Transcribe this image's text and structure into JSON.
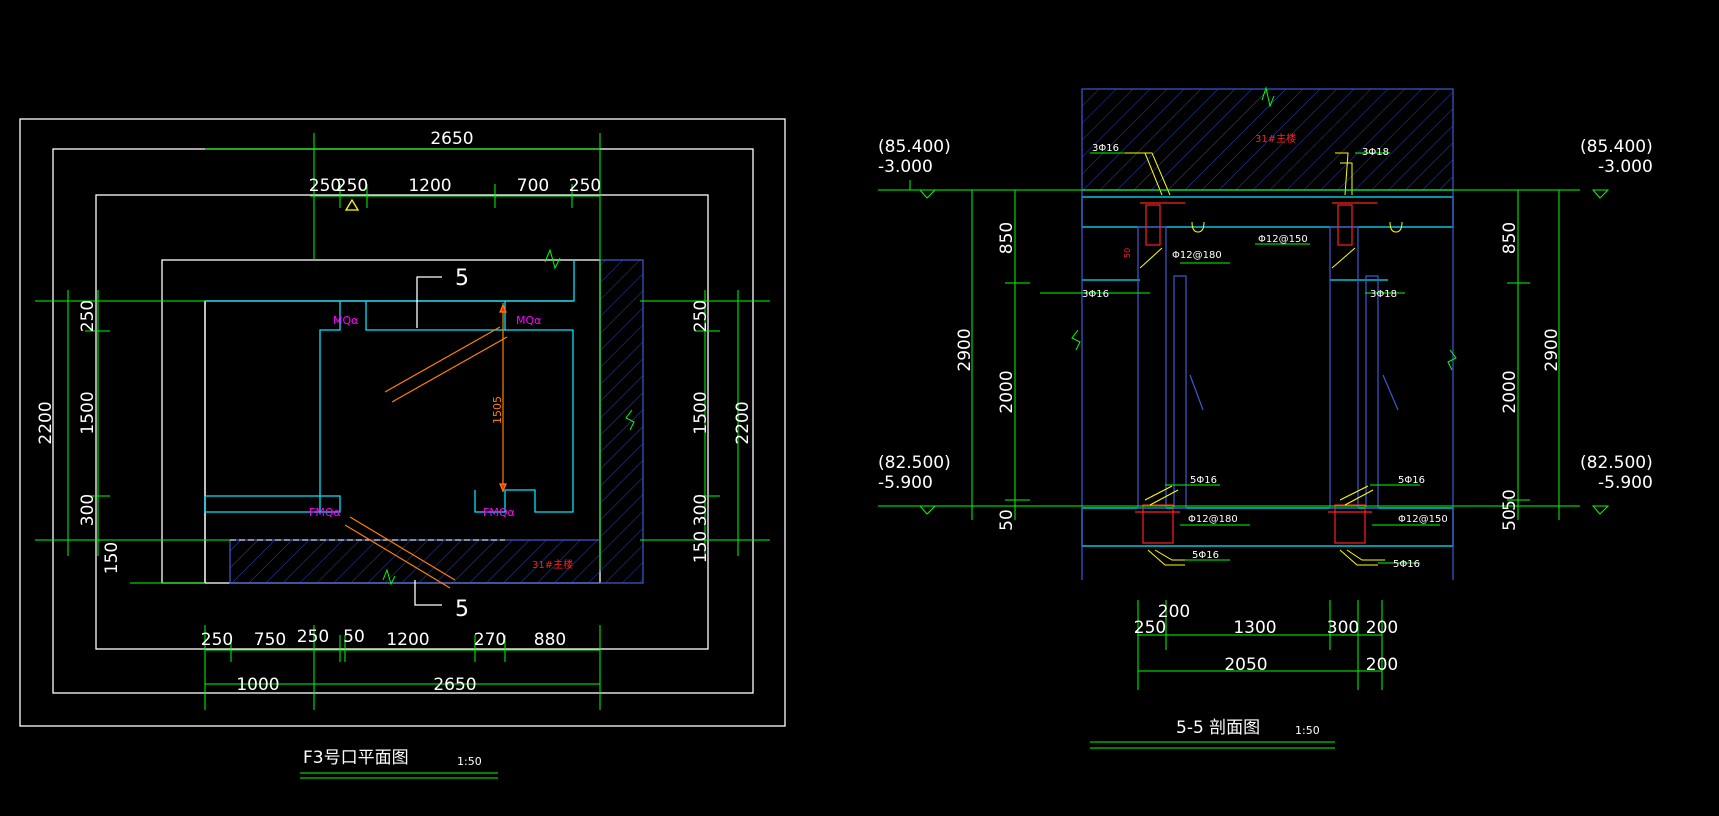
{
  "colors": {
    "background": "#000000",
    "white": "#ffffff",
    "green": "#00ff00",
    "cyan": "#00e5ff",
    "blue": "#3c5ad0",
    "hatch": "#2a44b8",
    "magenta": "#ff00ff",
    "red": "#ff2020",
    "orange": "#ff8000",
    "yellow": "#ffff00"
  },
  "plan": {
    "title": "F3号口平面图",
    "scale": "1:50",
    "dims_top_total": "2650",
    "dims_top": [
      "250",
      "250",
      "1200",
      "700",
      "250"
    ],
    "dims_bottom": [
      "250",
      "750",
      "250",
      "50",
      "1200",
      "270",
      "880"
    ],
    "dims_bottom_total_left": "1000",
    "dims_bottom_total": "2650",
    "dims_left_total": "2200",
    "dims_left": [
      "250",
      "1500",
      "300"
    ],
    "dims_left_extra": "150",
    "dims_right": [
      "250",
      "1500",
      "300"
    ],
    "dims_right_total": "2200",
    "dims_right_extra": "150",
    "door_labels": [
      "MQα",
      "MQα",
      "FMQα",
      "FMQα"
    ],
    "inner_dim": "1505",
    "wall_label": "31#主楼",
    "section_mark": "5"
  },
  "section": {
    "title": "5-5 剖面图",
    "scale": "1:50",
    "top_elev": "(85.400)",
    "top_level": "-3.000",
    "bottom_elev": "(82.500)",
    "bottom_level": "-5.900",
    "top_elev_right": "(85.400)",
    "top_level_right": "-3.000",
    "bottom_elev_right": "(82.500)",
    "bottom_level_right": "-5.900",
    "left_dims": [
      "850",
      "2000",
      "50"
    ],
    "left_total": "2900",
    "right_dims": [
      "850",
      "2000",
      "50"
    ],
    "right_total": "2900",
    "right_extra": "50",
    "bottom_top_label": "200",
    "bottom_dims": [
      "250",
      "1300",
      "300",
      "200"
    ],
    "bottom_total": "2050",
    "bottom_total_right": "200",
    "beam_label": "31#主楼",
    "rebar": {
      "l_top_outer": "3Φ16",
      "l_top_inner": "3Φ16",
      "r_top_outer": "3Φ18",
      "r_top_inner": "3Φ18",
      "slab_top_l": "Φ12@180",
      "slab_top_r": "Φ12@150",
      "l_bot_upper": "5Φ16",
      "l_bot_lower": "5Φ16",
      "r_bot_upper": "5Φ16",
      "r_bot_lower": "5Φ16",
      "slab_bot_l": "Φ12@180",
      "slab_bot_r": "Φ12@150",
      "col_dim": "50"
    }
  }
}
